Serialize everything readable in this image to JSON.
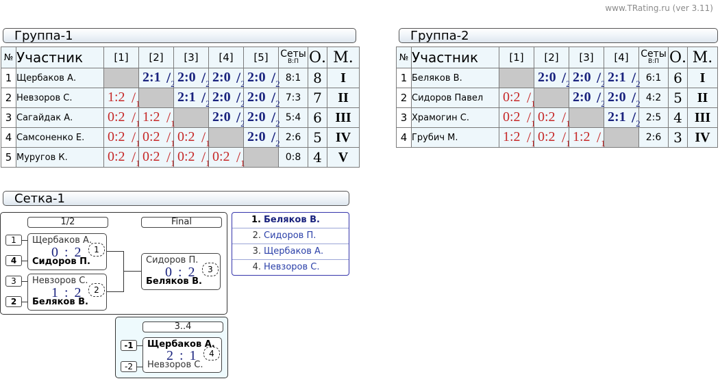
{
  "credit": "www.TRating.ru (ver 3.11)",
  "headers": {
    "num": "№",
    "name": "Участник",
    "sets": "Сеты",
    "sets_sub": "В:П",
    "points": "О.",
    "place": "М."
  },
  "group1": {
    "title": "Группа-1",
    "columns": [
      "[1]",
      "[2]",
      "[3]",
      "[4]",
      "[5]"
    ],
    "rows": [
      {
        "num": "1",
        "name": "Щербаков А.",
        "cells": [
          null,
          {
            "s": "2:1",
            "x": "2",
            "w": true
          },
          {
            "s": "2:0",
            "x": "2",
            "w": true
          },
          {
            "s": "2:0",
            "x": "2",
            "w": true
          },
          {
            "s": "2:0",
            "x": "2",
            "w": true
          }
        ],
        "sets": "8:1",
        "points": "8",
        "place": "I"
      },
      {
        "num": "2",
        "name": "Невзоров С.",
        "cells": [
          {
            "s": "1:2",
            "x": "1",
            "w": false
          },
          null,
          {
            "s": "2:1",
            "x": "2",
            "w": true
          },
          {
            "s": "2:0",
            "x": "2",
            "w": true
          },
          {
            "s": "2:0",
            "x": "2",
            "w": true
          }
        ],
        "sets": "7:3",
        "points": "7",
        "place": "II"
      },
      {
        "num": "3",
        "name": "Сагайдак А.",
        "cells": [
          {
            "s": "0:2",
            "x": "1",
            "w": false
          },
          {
            "s": "1:2",
            "x": "1",
            "w": false
          },
          null,
          {
            "s": "2:0",
            "x": "2",
            "w": true
          },
          {
            "s": "2:0",
            "x": "2",
            "w": true
          }
        ],
        "sets": "5:4",
        "points": "6",
        "place": "III"
      },
      {
        "num": "4",
        "name": "Самсоненко Е.",
        "cells": [
          {
            "s": "0:2",
            "x": "1",
            "w": false
          },
          {
            "s": "0:2",
            "x": "1",
            "w": false
          },
          {
            "s": "0:2",
            "x": "1",
            "w": false
          },
          null,
          {
            "s": "2:0",
            "x": "2",
            "w": true
          }
        ],
        "sets": "2:6",
        "points": "5",
        "place": "IV"
      },
      {
        "num": "5",
        "name": "Муругов К.",
        "cells": [
          {
            "s": "0:2",
            "x": "1",
            "w": false
          },
          {
            "s": "0:2",
            "x": "1",
            "w": false
          },
          {
            "s": "0:2",
            "x": "1",
            "w": false
          },
          {
            "s": "0:2",
            "x": "1",
            "w": false
          },
          null
        ],
        "sets": "0:8",
        "points": "4",
        "place": "V"
      }
    ]
  },
  "group2": {
    "title": "Группа-2",
    "columns": [
      "[1]",
      "[2]",
      "[3]",
      "[4]"
    ],
    "rows": [
      {
        "num": "1",
        "name": "Беляков В.",
        "cells": [
          null,
          {
            "s": "2:0",
            "x": "2",
            "w": true
          },
          {
            "s": "2:0",
            "x": "2",
            "w": true
          },
          {
            "s": "2:1",
            "x": "2",
            "w": true
          }
        ],
        "sets": "6:1",
        "points": "6",
        "place": "I"
      },
      {
        "num": "2",
        "name": "Сидоров Павел",
        "cells": [
          {
            "s": "0:2",
            "x": "1",
            "w": false
          },
          null,
          {
            "s": "2:0",
            "x": "2",
            "w": true
          },
          {
            "s": "2:0",
            "x": "2",
            "w": true
          }
        ],
        "sets": "4:2",
        "points": "5",
        "place": "II"
      },
      {
        "num": "3",
        "name": "Храмогин С.",
        "cells": [
          {
            "s": "0:2",
            "x": "1",
            "w": false
          },
          {
            "s": "0:2",
            "x": "1",
            "w": false
          },
          null,
          {
            "s": "2:1",
            "x": "2",
            "w": true
          }
        ],
        "sets": "2:5",
        "points": "4",
        "place": "III"
      },
      {
        "num": "4",
        "name": "Грубич М.",
        "cells": [
          {
            "s": "1:2",
            "x": "1",
            "w": false
          },
          {
            "s": "0:2",
            "x": "1",
            "w": false
          },
          {
            "s": "1:2",
            "x": "1",
            "w": false
          },
          null
        ],
        "sets": "2:6",
        "points": "3",
        "place": "IV"
      }
    ]
  },
  "bracket": {
    "title": "Сетка-1",
    "semi_label": "1/2",
    "final_label": "Final",
    "third_label": "3..4",
    "seeds": {
      "s1": "1",
      "s4": "4",
      "s3": "3",
      "s2": "2",
      "t1": "-1",
      "t2": "-2"
    },
    "m1": {
      "p1": "Щербаков А.",
      "p2": "Сидоров П.",
      "score": "0 : 2",
      "no": "1"
    },
    "m2": {
      "p1": "Невзоров С.",
      "p2": "Беляков В.",
      "score": "1 : 2",
      "no": "2"
    },
    "m3": {
      "p1": "Сидоров П.",
      "p2": "Беляков В.",
      "score": "0 : 2",
      "no": "3"
    },
    "m4": {
      "p1": "Щербаков А.",
      "p2": "Невзоров С.",
      "score": "2 : 1",
      "no": "4"
    }
  },
  "results": [
    {
      "n": "1.",
      "name": "Беляков В."
    },
    {
      "n": "2.",
      "name": "Сидоров П."
    },
    {
      "n": "3.",
      "name": "Щербаков А."
    },
    {
      "n": "4.",
      "name": "Невзоров С."
    }
  ],
  "colors": {
    "win": "#1a237e",
    "loss": "#c62828",
    "self": "#c8c8c8",
    "cell_bg": "#eef7fb"
  }
}
